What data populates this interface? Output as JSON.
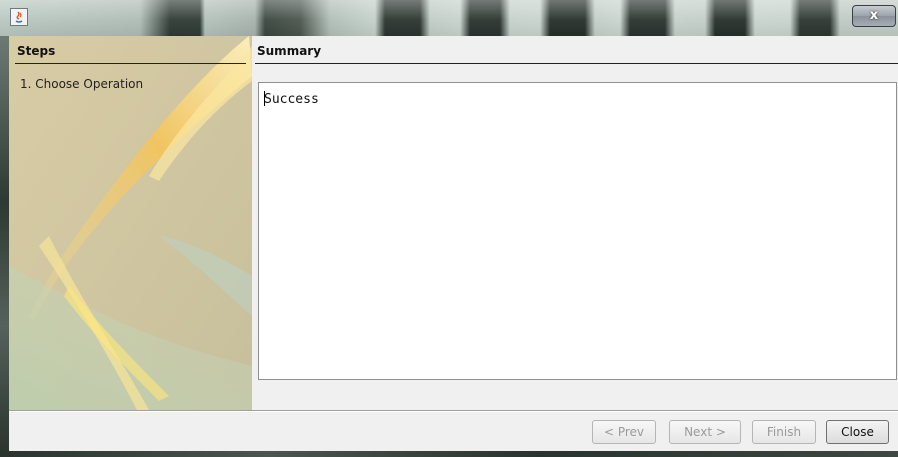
{
  "window": {
    "close_glyph": "x",
    "app_icon": "java-icon",
    "close_icon": "close-icon"
  },
  "steps": {
    "header": "Steps",
    "items": [
      "1. Choose Operation"
    ]
  },
  "summary": {
    "header": "Summary",
    "text": "Success"
  },
  "buttons": {
    "prev": "< Prev",
    "next": "Next >",
    "finish": "Finish",
    "close": "Close"
  },
  "colors": {
    "panel_bg": "#f0f0f0",
    "steps_bg": "#cfc3a0",
    "text_area_bg": "#ffffff"
  }
}
